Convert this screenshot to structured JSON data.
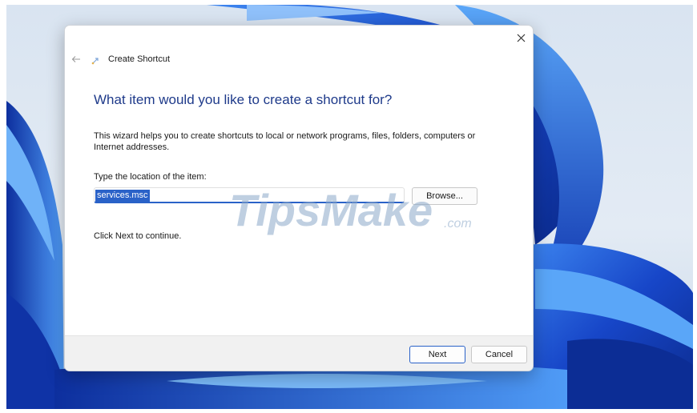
{
  "dialog": {
    "title": "Create Shortcut",
    "heading": "What item would you like to create a shortcut for?",
    "description": "This wizard helps you to create shortcuts to local or network programs, files, folders, computers or Internet addresses.",
    "location_label": "Type the location of the item:",
    "location_value": "services.msc",
    "browse_label": "Browse...",
    "continue_text": "Click Next to continue.",
    "next_label": "Next",
    "cancel_label": "Cancel"
  },
  "watermark": {
    "brand": "TipsMake",
    "suffix": ".com"
  },
  "colors": {
    "accent": "#2a62c8",
    "heading": "#1e3a8a",
    "wallpaper_blue": "#1747c9",
    "wallpaper_light": "#dfe8f3"
  },
  "icons": {
    "back": "back-arrow-icon",
    "close": "close-icon",
    "wizard": "shortcut-wizard-icon"
  }
}
